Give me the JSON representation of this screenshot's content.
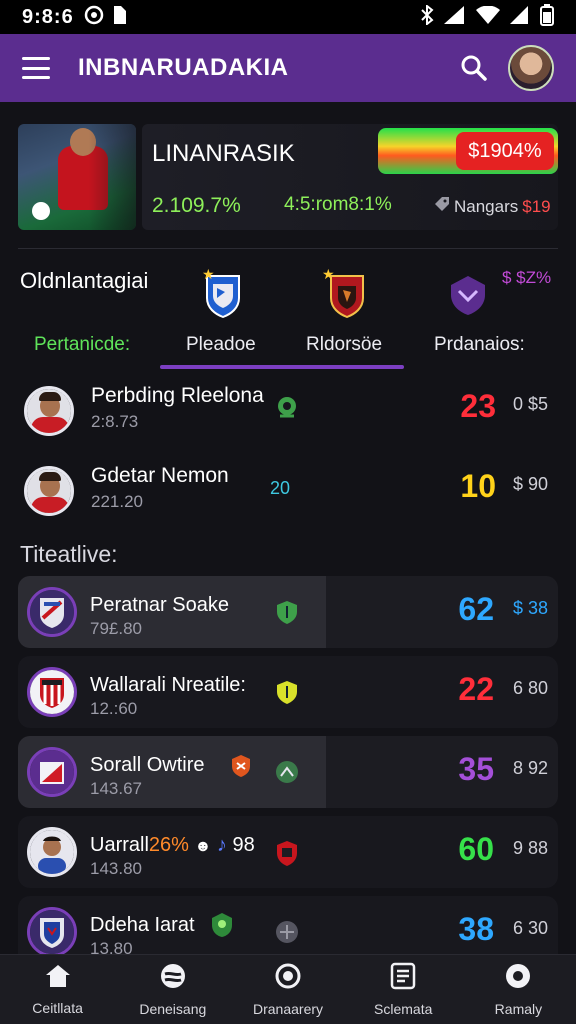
{
  "status": {
    "time": "9:8:6"
  },
  "appbar": {
    "title": "INBNARUADAKIA"
  },
  "hero": {
    "title": "LINANRASIK",
    "badge": "$1904%",
    "stat1": "2.109.7%",
    "stat2": "4:5:rom8:1%",
    "nangs_label": "Nangars",
    "nangs_value": "$19"
  },
  "filters": {
    "heading": "Oldnlantagiai",
    "top_right": "$ $Z%",
    "tabs": [
      {
        "label": "Pertanicde:",
        "color": "#5fe35a"
      },
      {
        "label": "Pleadoe",
        "color": "#ffffff"
      },
      {
        "label": "Rldorsöe",
        "color": "#ffffff"
      },
      {
        "label": "Prdanaios:",
        "color": "#ffffff"
      }
    ]
  },
  "players": [
    {
      "name": "Perbding Rleelona",
      "sub": "2:8.73",
      "score": "23",
      "score_color": "#ff2e3a",
      "extra": "0 $5"
    },
    {
      "name": "Gdetar Nemon",
      "sub": "221.20",
      "badge": "20",
      "score": "10",
      "score_color": "#ffd21a",
      "extra": "$ 90"
    }
  ],
  "section2": {
    "title": "Titeatlive:"
  },
  "rankings": [
    {
      "name": "Peratnar Soake",
      "sub": "79£.80",
      "score": "62",
      "score_color": "#2ea8ff",
      "extra": "$ 38",
      "extra_color": "#2ea8ff",
      "shield_color": "#3ea04a",
      "crest_color": "#7a3fb8",
      "highlight": true
    },
    {
      "name": "Wallarali Nreatile:",
      "sub": "12.:60",
      "score": "22",
      "score_color": "#ff2e3a",
      "extra": "6 80",
      "extra_color": "#d0d0d8",
      "shield_color": "#d8e02a",
      "crest_color": "#c8161e",
      "highlight": false
    },
    {
      "name": "Sorall Owtire",
      "sub": "143.67",
      "score": "35",
      "score_color": "#a44fd8",
      "extra": "8 92",
      "extra_color": "#d0d0d8",
      "shield_color": "#3a7a4a",
      "crest_color": "#d01c26",
      "highlight": true
    },
    {
      "name": "Uarrall",
      "name_accent": "26%",
      "name_tail": "98",
      "sub": "143.80",
      "score": "60",
      "score_color": "#36e04a",
      "extra": "9 88",
      "extra_color": "#d0d0d8",
      "shield_color": "#c8161e",
      "crest_color": "#e6e6ee",
      "highlight": false
    },
    {
      "name": "Ddeha Iarat",
      "sub": "13.80",
      "score": "38",
      "score_color": "#2ea8ff",
      "extra": "6 30",
      "extra_color": "#d0d0d8",
      "shield_color": "#555560",
      "crest_color": "#5b2d8f",
      "highlight": false
    }
  ],
  "nav": [
    {
      "label": "Ceitllata",
      "icon": "home-icon"
    },
    {
      "label": "Deneisang",
      "icon": "ball-icon"
    },
    {
      "label": "Dranaarery",
      "icon": "target-icon"
    },
    {
      "label": "Sclemata",
      "icon": "list-icon"
    },
    {
      "label": "Ramaly",
      "icon": "circle-icon"
    }
  ]
}
